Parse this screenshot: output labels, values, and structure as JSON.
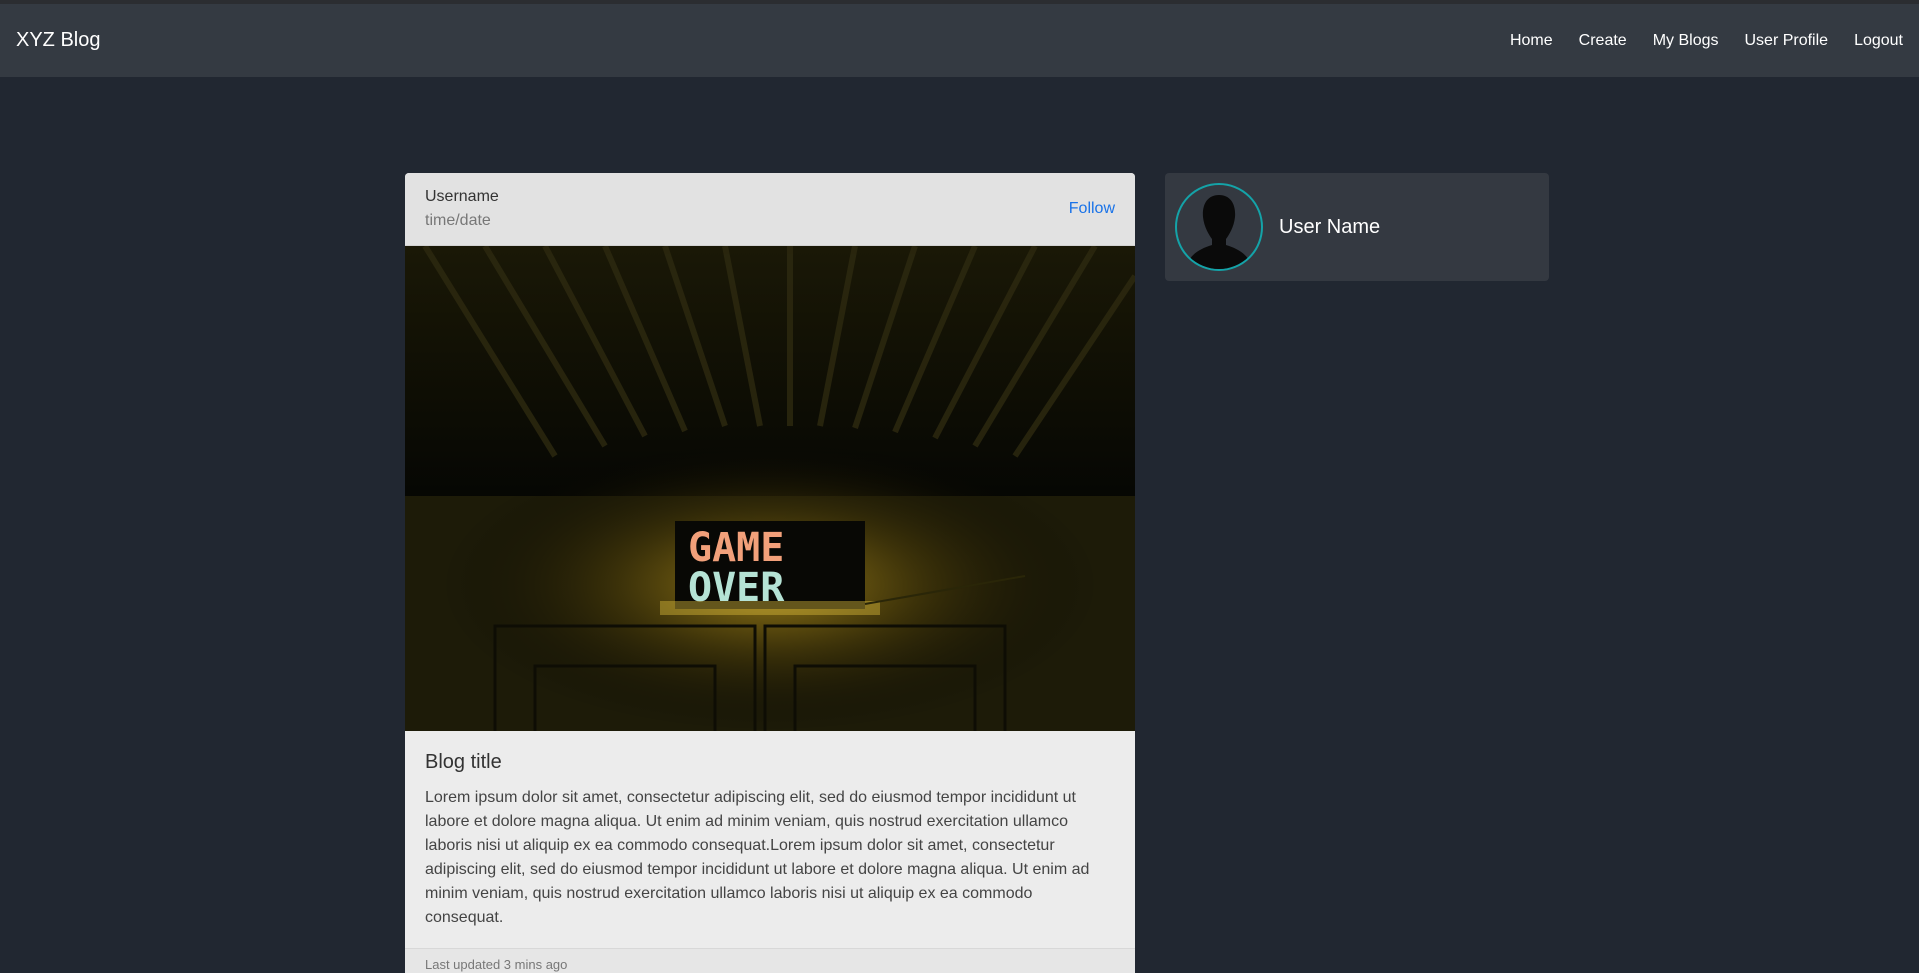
{
  "navbar": {
    "brand": "XYZ Blog",
    "links": [
      "Home",
      "Create",
      "My Blogs",
      "User Profile",
      "Logout"
    ]
  },
  "post": {
    "author": "Username",
    "time": "time/date",
    "follow_label": "Follow",
    "image_text": "GAME OVER",
    "title": "Blog title",
    "body": "Lorem ipsum dolor sit amet, consectetur adipiscing elit, sed do eiusmod tempor incididunt ut labore et dolore magna aliqua. Ut enim ad minim veniam, quis nostrud exercitation ullamco laboris nisi ut aliquip ex ea commodo consequat.Lorem ipsum dolor sit amet, consectetur adipiscing elit, sed do eiusmod tempor incididunt ut labore et dolore magna aliqua. Ut enim ad minim veniam, quis nostrud exercitation ullamco laboris nisi ut aliquip ex ea commodo consequat.",
    "footer": "Last updated 3 mins ago"
  },
  "profile": {
    "name": "User Name",
    "avatar_icon": "user-silhouette-icon"
  },
  "colors": {
    "page_bg": "#212731",
    "navbar_bg": "#343a42",
    "accent_link": "#1a73e8",
    "avatar_ring": "#14a3a8"
  }
}
